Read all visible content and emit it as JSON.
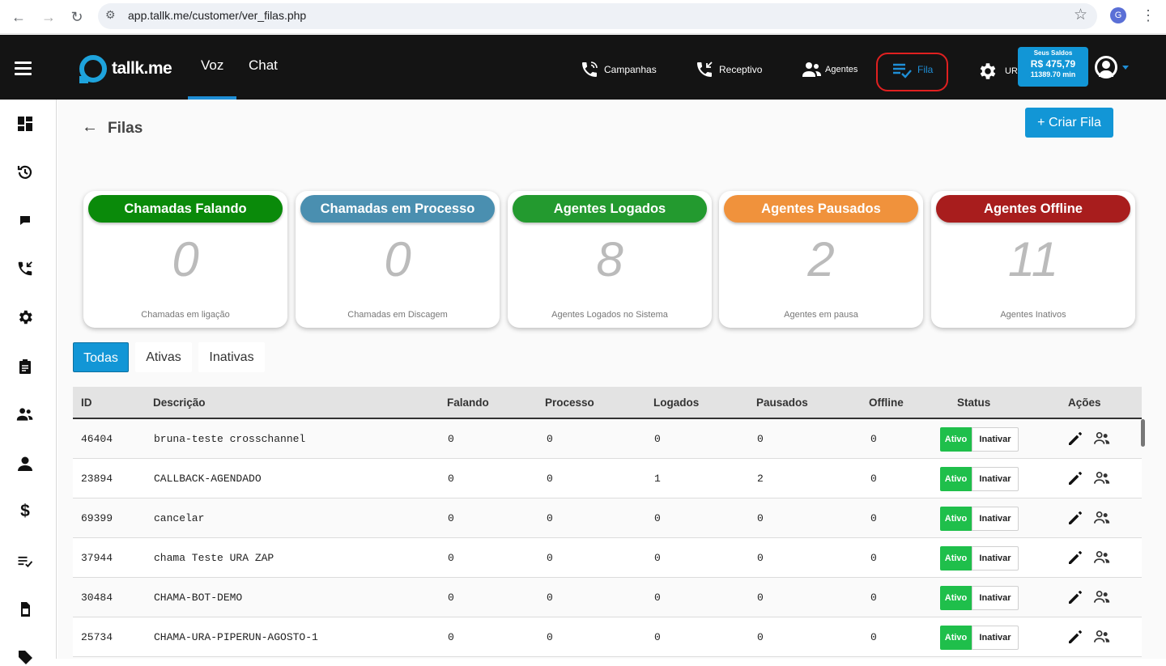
{
  "browser": {
    "url": "app.tallk.me/customer/ver_filas.php",
    "profile_initial": "G"
  },
  "app": {
    "logo_text": "tallk.me",
    "tabs": [
      {
        "label": "Voz"
      },
      {
        "label": "Chat"
      }
    ],
    "menu": [
      {
        "label": "Campanhas",
        "icon": "phone-ring-icon"
      },
      {
        "label": "Receptivo",
        "icon": "phone-incoming-icon"
      },
      {
        "label": "Agentes",
        "icon": "users-icon"
      },
      {
        "label": "Fila",
        "icon": "queue-list-icon"
      }
    ],
    "uri_label": "UR",
    "saldo": {
      "title": "Seus Saldos",
      "amount": "R$ 475,79",
      "minutes": "11389.70 min"
    }
  },
  "colors": {
    "accent": "#1296d6",
    "falando": "#0a8a0a",
    "processo": "#4a8fb0",
    "logados": "#239a2f",
    "pausados": "#f0923c",
    "offline": "#a81d1d",
    "ativo": "#1fbf4b"
  },
  "page": {
    "title": "Filas",
    "create_button": "+ Criar Fila"
  },
  "stats": [
    {
      "title": "Chamadas Falando",
      "value": "0",
      "subtitle": "Chamadas em ligação",
      "color": "#0a8a0a"
    },
    {
      "title": "Chamadas em Processo",
      "value": "0",
      "subtitle": "Chamadas em Discagem",
      "color": "#4a8fb0"
    },
    {
      "title": "Agentes Logados",
      "value": "8",
      "subtitle": "Agentes Logados no Sistema",
      "color": "#239a2f"
    },
    {
      "title": "Agentes Pausados",
      "value": "2",
      "subtitle": "Agentes em pausa",
      "color": "#f0923c"
    },
    {
      "title": "Agentes Offline",
      "value": "11",
      "subtitle": "Agentes Inativos",
      "color": "#a81d1d"
    }
  ],
  "filters": [
    {
      "label": "Todas"
    },
    {
      "label": "Ativas"
    },
    {
      "label": "Inativas"
    }
  ],
  "table": {
    "headers": [
      "ID",
      "Descrição",
      "Falando",
      "Processo",
      "Logados",
      "Pausados",
      "Offline",
      "Status",
      "Ações"
    ],
    "status_labels": {
      "active": "Ativo",
      "deactivate": "Inativar"
    },
    "rows": [
      {
        "id": "46404",
        "descricao": "bruna-teste crosschannel",
        "falando": "0",
        "processo": "0",
        "logados": "0",
        "pausados": "0",
        "offline": "0"
      },
      {
        "id": "23894",
        "descricao": "CALLBACK-AGENDADO",
        "falando": "0",
        "processo": "0",
        "logados": "1",
        "pausados": "2",
        "offline": "0"
      },
      {
        "id": "69399",
        "descricao": "cancelar",
        "falando": "0",
        "processo": "0",
        "logados": "0",
        "pausados": "0",
        "offline": "0"
      },
      {
        "id": "37944",
        "descricao": "chama Teste URA ZAP",
        "falando": "0",
        "processo": "0",
        "logados": "0",
        "pausados": "0",
        "offline": "0"
      },
      {
        "id": "30484",
        "descricao": "CHAMA-BOT-DEMO",
        "falando": "0",
        "processo": "0",
        "logados": "0",
        "pausados": "0",
        "offline": "0"
      },
      {
        "id": "25734",
        "descricao": "CHAMA-URA-PIPERUN-AGOSTO-1",
        "falando": "0",
        "processo": "0",
        "logados": "0",
        "pausados": "0",
        "offline": "0"
      }
    ]
  }
}
